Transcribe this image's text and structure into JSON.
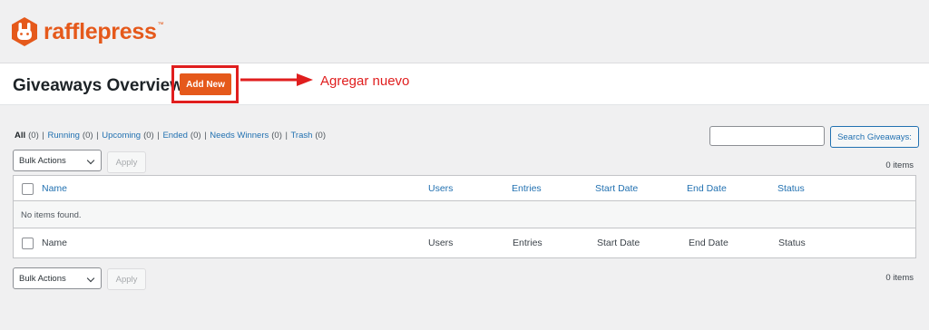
{
  "brand": {
    "name": "rafflepress",
    "trademark": "™",
    "color": "#e5591b"
  },
  "header": {
    "title": "Giveaways Overview",
    "add_new_label": "Add New"
  },
  "annotation": {
    "text": "Agregar nuevo",
    "color": "#e01e1e"
  },
  "filters": [
    {
      "label": "All",
      "count": "(0)",
      "current": true
    },
    {
      "label": "Running",
      "count": "(0)"
    },
    {
      "label": "Upcoming",
      "count": "(0)"
    },
    {
      "label": "Ended",
      "count": "(0)"
    },
    {
      "label": "Needs Winners",
      "count": "(0)"
    },
    {
      "label": "Trash",
      "count": "(0)"
    }
  ],
  "search": {
    "value": "",
    "button_label": "Search Giveaways:"
  },
  "top_nav": {
    "bulk_actions": "Bulk Actions",
    "apply": "Apply",
    "items": "0 items"
  },
  "bottom_nav": {
    "bulk_actions": "Bulk Actions",
    "apply": "Apply",
    "items": "0 items"
  },
  "table": {
    "columns": [
      "Name",
      "Users",
      "Entries",
      "Start Date",
      "End Date",
      "Status"
    ],
    "empty_message": "No items found."
  }
}
